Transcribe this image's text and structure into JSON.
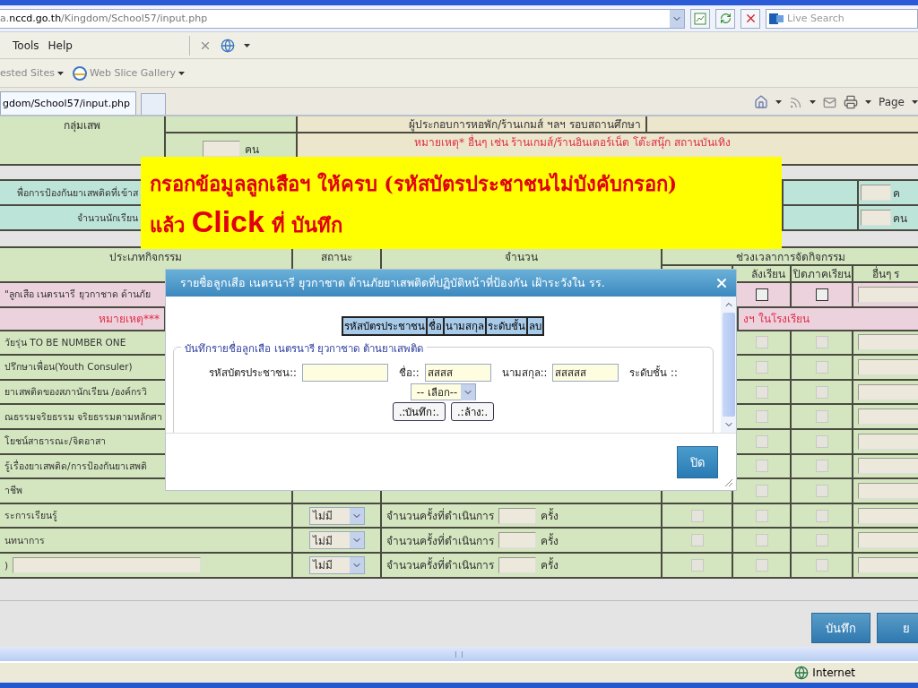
{
  "browser": {
    "address": "a.**nccd.go.th**/Kingdom/School57/input.php",
    "search_placeholder": "Live Search",
    "menu": [
      "Tools",
      "Help"
    ],
    "favorites": [
      "ested Sites",
      "Web Slice Gallery"
    ],
    "tabs": [
      {
        "label": "gdom/School57/input.php",
        "selected": true
      }
    ],
    "page_menu": "Page",
    "status_zone": "Internet"
  },
  "form": {
    "group_label": "กลุ่มเสพ",
    "group_unit": "คน",
    "venue_heading": "ผู้ประกอบการหอพัก/ร้านเกมส์ ฯลฯ รอบสถานศึกษา",
    "venue_note": "หมายเหตุ* อื่นๆ เช่น ร้านเกมส์/ร้านอินเตอร์เน็ต โต๊ะสนุ๊ก สถานบันเทิง",
    "counts": [
      {
        "label": "พื่อการป้องกันยาเสพติดที่เข้าส",
        "unit": "ค"
      },
      {
        "label": "จำนวนนักเรียน",
        "unit": "คน"
      }
    ],
    "columns": [
      "ประเภทกิจกรรม",
      "สถานะ",
      "จำนวน",
      "ช่วงเวลาการจัดกิจกรรม"
    ],
    "subcolumns": [
      "ลังเรียน",
      "ปิดภาคเรียน",
      "อื่นๆ ร"
    ],
    "activities": [
      {
        "kind": "category",
        "label": "\"ลูกเสือ เนตรนารี ยุวกาชาด ด้านภัย",
        "checks": [
          {
            "checked": false,
            "disabled": false
          },
          {
            "checked": false,
            "disabled": false
          }
        ]
      },
      {
        "kind": "note",
        "label": "หมายเหตุ***",
        "detail": "งฯ ในโรงเรียน"
      },
      {
        "kind": "activity",
        "label": "วัยรุ่น TO BE NUMBER ONE",
        "checks": [
          {
            "checked": false,
            "disabled": true
          },
          {
            "checked": false,
            "disabled": true
          }
        ]
      },
      {
        "kind": "activity",
        "label": "ปรึกษาเพื่อน(Youth Consuler)",
        "checks": [
          {
            "checked": false,
            "disabled": true
          },
          {
            "checked": false,
            "disabled": true
          }
        ]
      },
      {
        "kind": "activity",
        "label": "ยาเสพติดของสภานักเรียน /องค์กรวิ",
        "checks": [
          {
            "checked": false,
            "disabled": true
          },
          {
            "checked": false,
            "disabled": true
          }
        ]
      },
      {
        "kind": "activity",
        "label": "ณธรรมจริยธรรม จริยธรรมตามหลักศา",
        "checks": [
          {
            "checked": false,
            "disabled": true
          },
          {
            "checked": false,
            "disabled": true
          }
        ]
      },
      {
        "kind": "activity",
        "label": "โยชน์สาธารณะ/จิตอาสา",
        "checks": [
          {
            "checked": false,
            "disabled": true
          },
          {
            "checked": false,
            "disabled": true
          }
        ]
      },
      {
        "kind": "activity",
        "label": "รู้เรื่องยาเสพติด/การป้องกันยาเสพติ",
        "checks": [
          {
            "checked": false,
            "disabled": true
          },
          {
            "checked": false,
            "disabled": true
          }
        ]
      },
      {
        "kind": "activity",
        "label": "าชีพ",
        "checks": [
          {
            "checked": false,
            "disabled": true
          },
          {
            "checked": false,
            "disabled": true
          }
        ]
      },
      {
        "kind": "activity",
        "label": "ระการเรียนรู้",
        "status": "ไม่มี",
        "count_label": "จำนวนครั้งที่ดำเนินการ",
        "unit": "ครั้ง",
        "checks": [
          {
            "checked": false,
            "disabled": true
          },
          {
            "checked": false,
            "disabled": true
          },
          {
            "checked": false,
            "disabled": true
          }
        ]
      },
      {
        "kind": "activity",
        "label": "นทนาการ",
        "status": "ไม่มี",
        "count_label": "จำนวนครั้งที่ดำเนินการ",
        "unit": "ครั้ง",
        "checks": [
          {
            "checked": false,
            "disabled": true
          },
          {
            "checked": false,
            "disabled": true
          },
          {
            "checked": false,
            "disabled": true
          }
        ]
      },
      {
        "kind": "custom",
        "label": ")",
        "status": "ไม่มี",
        "count_label": "จำนวนครั้งที่ดำเนินการ",
        "unit": "ครั้ง",
        "checks": [
          {
            "checked": false,
            "disabled": true
          },
          {
            "checked": false,
            "disabled": true
          },
          {
            "checked": false,
            "disabled": true
          }
        ]
      }
    ],
    "buttons": [
      "บันทึก",
      "ย"
    ]
  },
  "dialog": {
    "title": "รายชื่อลูกเสือ เนตรนารี ยุวกาชาด ต้านภัยยาเสพติดที่ปฏิบัติหน้าที่ป้องกัน เฝ้าระวังใน รร.",
    "list_columns": [
      "รหัสบัตรประชาชน",
      "ชื่อ",
      "นามสกุล",
      "ระดับชั้น",
      "ลบ"
    ],
    "legend": "บันทึกรายชื่อลูกเสือ เนตรนารี ยุวกาชาด ต้านยาเสพติด",
    "fields": [
      {
        "kind": "input",
        "label": "รหัสบัตรประชาชน::"
      },
      {
        "kind": "input",
        "label": "ชื่อ::",
        "value": "สสสส"
      },
      {
        "kind": "input",
        "label": "นามสกุล::",
        "value": "สสสสส"
      },
      {
        "kind": "label",
        "label": "ระดับชั้น ::"
      }
    ],
    "level_select": "-- เลือก--",
    "actions": [
      ".:บันทึก:.",
      ".:ล้าง:."
    ],
    "close_button": "ปิด"
  },
  "callout": {
    "lines": [
      "กรอกข้อมูลลูกเสือฯ ให้ครบ (รหัสบัตรประชาชนไม่บังคับกรอก)",
      "แล้ว **Click** ที่ บันทึก"
    ]
  }
}
